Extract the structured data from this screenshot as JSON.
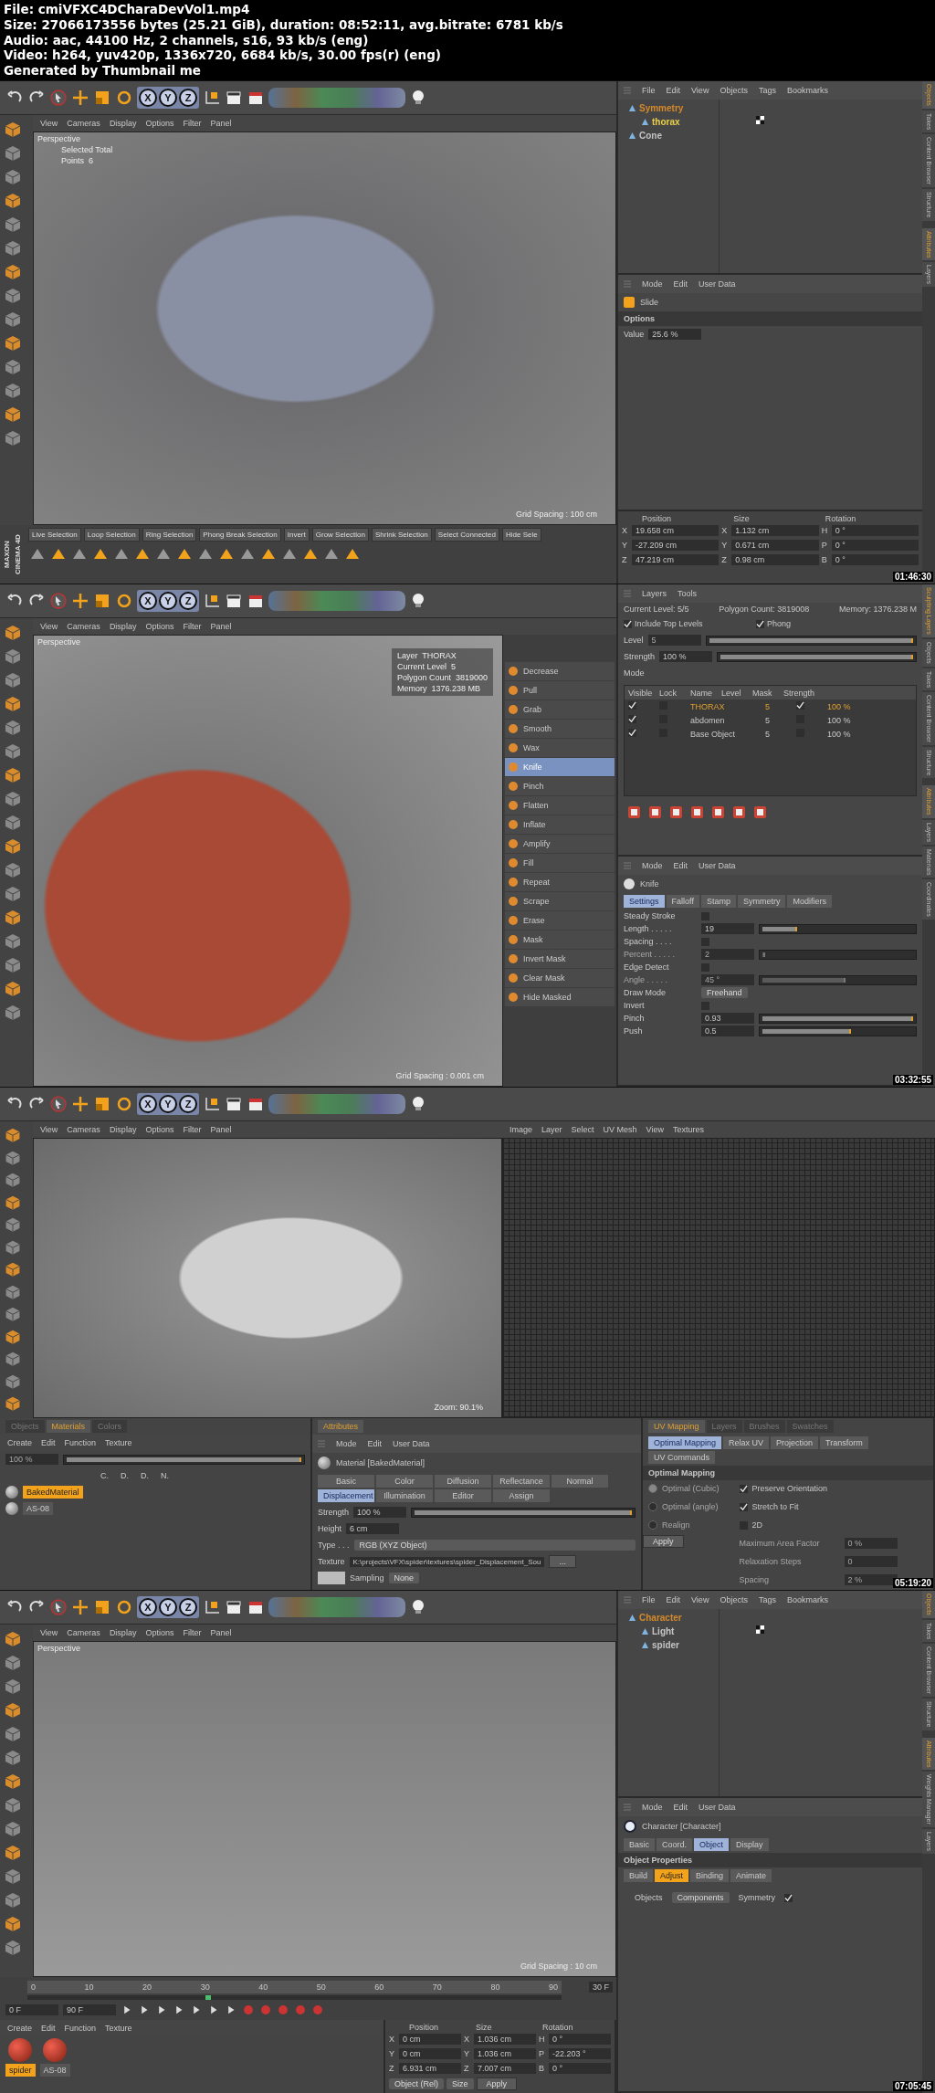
{
  "header": {
    "lines": [
      "File: cmiVFXC4DCharaDevVol1.mp4",
      "Size: 27066173556 bytes (25.21 GiB), duration: 08:52:11, avg.bitrate: 6781 kb/s",
      "Audio: aac, 44100 Hz, 2 channels, s16, 93 kb/s (eng)",
      "Video: h264, yuv420p, 1336x720, 6684 kb/s, 30.00 fps(r) (eng)",
      "Generated by Thumbnail me"
    ]
  },
  "frames": [
    {
      "kind": "modeling",
      "timestamp": "01:46:30",
      "toolbar": {
        "axes": [
          "X",
          "Y",
          "Z"
        ]
      },
      "viewport": {
        "menu": [
          "View",
          "Cameras",
          "Display",
          "Options",
          "Filter",
          "Panel"
        ],
        "camera": "Perspective",
        "info": [
          "Selected Total",
          "Points  6"
        ],
        "grid": "Grid Spacing : 100 cm"
      },
      "selection_bar": [
        "Live Selection",
        "Loop Selection",
        "Ring Selection",
        "Phong Break Selection",
        "Invert",
        "Grow Selection",
        "Shrink Selection",
        "Select Connected",
        "Hide Sele"
      ],
      "logo": [
        "MAXON",
        "CINEMA 4D"
      ],
      "objects": {
        "menu": [
          "File",
          "Edit",
          "View",
          "Objects",
          "Tags",
          "Bookmarks"
        ],
        "items": [
          {
            "name": "Symmetry",
            "color": "#d4892a",
            "children": [
              {
                "name": "thorax",
                "color": "#e8cf4a"
              }
            ]
          },
          {
            "name": "Cone",
            "color": "#c4c4c4"
          }
        ]
      },
      "attributes": {
        "menu": [
          "Mode",
          "Edit",
          "User Data"
        ],
        "title": "Slide",
        "section": "Options",
        "fields": [
          {
            "label": "Value",
            "value": "25.6 %"
          }
        ]
      },
      "coordinates": {
        "headers": [
          "Position",
          "Size",
          "Rotation"
        ],
        "rows": [
          {
            "pos_axis": "X",
            "position": "19.658 cm",
            "size_axis": "X",
            "size": "1.132 cm",
            "rot_axis": "H",
            "rotation": "0 °"
          },
          {
            "pos_axis": "Y",
            "position": "-27.209 cm",
            "size_axis": "Y",
            "size": "0.671 cm",
            "rot_axis": "P",
            "rotation": "0 °"
          },
          {
            "pos_axis": "Z",
            "position": "47.219 cm",
            "size_axis": "Z",
            "size": "0.98 cm",
            "rot_axis": "B",
            "rotation": "0 °"
          }
        ]
      },
      "side_tabs": [
        [
          {
            "label": "Objects",
            "selected": true
          },
          {
            "label": "Takes",
            "selected": false
          },
          {
            "label": "Content Browser",
            "selected": false
          },
          {
            "label": "Structure",
            "selected": false
          }
        ],
        [
          {
            "label": "Attributes",
            "selected": true
          },
          {
            "label": "Layers",
            "selected": false
          }
        ]
      ]
    },
    {
      "kind": "sculpt",
      "timestamp": "03:32:55",
      "toolbar": {
        "axes": [
          "X",
          "Y",
          "Z"
        ]
      },
      "viewport": {
        "menu": [
          "View",
          "Cameras",
          "Display",
          "Options",
          "Filter",
          "Panel"
        ],
        "camera": "Perspective",
        "info": [
          "Layer  THORAX",
          "Current Level  5",
          "Polygon Count  3819000",
          "Memory  1376.238 MB"
        ],
        "grid": "Grid Spacing : 0.001 cm"
      },
      "brushes": [
        {
          "name": "Decrease",
          "selected": false
        },
        {
          "name": "Pull",
          "selected": false
        },
        {
          "name": "Grab",
          "selected": false
        },
        {
          "name": "Smooth",
          "selected": false
        },
        {
          "name": "Wax",
          "selected": false
        },
        {
          "name": "Knife",
          "selected": true
        },
        {
          "name": "Pinch",
          "selected": false
        },
        {
          "name": "Flatten",
          "selected": false
        },
        {
          "name": "Inflate",
          "selected": false
        },
        {
          "name": "Amplify",
          "selected": false
        },
        {
          "name": "Fill",
          "selected": false
        },
        {
          "name": "Repeat",
          "selected": false
        },
        {
          "name": "Scrape",
          "selected": false
        },
        {
          "name": "Erase",
          "selected": false
        },
        {
          "name": "Mask",
          "selected": false
        },
        {
          "name": "Invert Mask",
          "selected": false
        },
        {
          "name": "Clear Mask",
          "selected": false
        },
        {
          "name": "Hide Masked",
          "selected": false
        }
      ],
      "layers": {
        "menu": [
          "Layers",
          "Tools"
        ],
        "stats": [
          "Current Level: 5/5",
          "Polygon Count: 3819008",
          "Memory: 1376.238 M"
        ],
        "checks": [
          {
            "label": "Include Top Levels",
            "checked": true
          },
          {
            "label": "Phong",
            "checked": true
          }
        ],
        "level_row": {
          "label": "Level",
          "value": "5",
          "level": 1
        },
        "strength": {
          "label": "Strength",
          "value": "100 %",
          "level": 1
        },
        "mode": "Mode",
        "columns": [
          "Visible",
          "Lock",
          "Name",
          "Level",
          "Mask",
          "Strength"
        ],
        "rows": [
          {
            "visible": true,
            "locked": false,
            "name": "THORAX",
            "subdivision": "5",
            "mask": true,
            "strength": "100 %",
            "selected": true
          },
          {
            "visible": true,
            "locked": false,
            "name": "abdomen",
            "subdivision": "5",
            "mask": false,
            "strength": "100 %",
            "selected": false
          },
          {
            "visible": true,
            "locked": false,
            "name": "Base Object",
            "subdivision": "5",
            "mask": false,
            "strength": "100 %",
            "selected": false
          }
        ]
      },
      "attributes": {
        "menu": [
          "Mode",
          "Edit",
          "User Data"
        ],
        "title": "Knife",
        "tabs": [
          {
            "label": "Settings",
            "selected": true
          },
          {
            "label": "Falloff",
            "selected": false
          },
          {
            "label": "Stamp",
            "selected": false
          },
          {
            "label": "Symmetry",
            "selected": false
          },
          {
            "label": "Modifiers",
            "selected": false
          }
        ],
        "settings": [
          {
            "kind": "check",
            "label": "Steady Stroke",
            "checked": false
          },
          {
            "kind": "slider",
            "label": "Length . . . . .",
            "value": "19",
            "level": 0.23,
            "disabled": false
          },
          {
            "kind": "check",
            "label": "Spacing . . . .",
            "checked": false
          },
          {
            "kind": "slider",
            "label": "Percent . . . . .",
            "value": "2",
            "level": 0.02,
            "disabled": true
          },
          {
            "kind": "check",
            "label": "Edge Detect",
            "checked": false
          },
          {
            "kind": "slider",
            "label": "Angle . . . . .",
            "value": "45 °",
            "level": 0.55,
            "disabled": true
          },
          {
            "kind": "dropdown",
            "label": "Draw Mode",
            "value": "Freehand"
          },
          {
            "kind": "check",
            "label": "Invert",
            "checked": false
          },
          {
            "kind": "slider",
            "label": "Pinch",
            "value": "0.93",
            "level": 1,
            "disabled": false
          },
          {
            "kind": "slider",
            "label": "Push",
            "value": "0.5",
            "level": 0.59,
            "disabled": false
          }
        ]
      },
      "side_tabs": [
        [
          {
            "label": "Sculpting Layers",
            "selected": true
          },
          {
            "label": "Objects",
            "selected": false
          },
          {
            "label": "Takes",
            "selected": false
          },
          {
            "label": "Content Browser",
            "selected": false
          },
          {
            "label": "Structure",
            "selected": false
          }
        ],
        [
          {
            "label": "Attributes",
            "selected": true
          },
          {
            "label": "Layers",
            "selected": false
          },
          {
            "label": "Materials",
            "selected": false
          },
          {
            "label": "Coordinates",
            "selected": false
          }
        ]
      ]
    },
    {
      "kind": "uv",
      "timestamp": "05:19:20",
      "toolbar": {
        "axes": [
          "X",
          "Y",
          "Z"
        ]
      },
      "viewport": {
        "menu": [
          "View",
          "Cameras",
          "Display",
          "Options",
          "Filter",
          "Panel"
        ],
        "zoom": "Zoom: 90.1%"
      },
      "uv_menu": [
        "Image",
        "Layer",
        "Select",
        "UV Mesh",
        "View",
        "Textures"
      ],
      "materials": {
        "tabs": [
          {
            "label": "Objects",
            "selected": false
          },
          {
            "label": "Materials",
            "selected": true
          },
          {
            "label": "Colors",
            "selected": false
          }
        ],
        "menu": [
          "Create",
          "Edit",
          "Function",
          "Texture"
        ],
        "zoom": "100 %",
        "zoom_slider": {
          "level": 1
        },
        "columns": [
          "C.",
          "D.",
          "D.",
          "N."
        ],
        "items": [
          {
            "name": "BakedMaterial",
            "selected": true
          },
          {
            "name": "AS-08",
            "selected": false
          }
        ]
      },
      "attributes": {
        "tab": "Attributes",
        "menu": [
          "Mode",
          "Edit",
          "User Data"
        ],
        "title": "Material [BakedMaterial]",
        "tabs": [
          {
            "label": "Basic",
            "selected": false
          },
          {
            "label": "Color",
            "selected": false
          },
          {
            "label": "Diffusion",
            "selected": false
          },
          {
            "label": "Reflectance",
            "selected": false
          },
          {
            "label": "Normal",
            "selected": false
          },
          {
            "label": "Displacement",
            "selected": true
          },
          {
            "label": "Illumination",
            "selected": false
          },
          {
            "label": "Editor",
            "selected": false
          },
          {
            "label": "Assign",
            "selected": false
          }
        ],
        "strength": {
          "label": "Strength",
          "value": "100 %",
          "level": 1
        },
        "height": {
          "label": "Height",
          "value": "6 cm"
        },
        "type": {
          "label": "Type . . .",
          "value": "RGB (XYZ Object)"
        },
        "texture": {
          "label": "Texture",
          "value": "K:\\projects\\VFX\\spider\\textures\\spider_Displacement_Sou",
          "button": "..."
        },
        "sampling": {
          "label": "Sampling",
          "value": "None"
        }
      },
      "uv_panel": {
        "tabs": [
          {
            "label": "UV Mapping",
            "selected": true
          },
          {
            "label": "Layers",
            "selected": false
          },
          {
            "label": "Brushes",
            "selected": false
          },
          {
            "label": "Swatches",
            "selected": false
          }
        ],
        "subtabs": [
          {
            "label": "Optimal Mapping",
            "selected": true
          },
          {
            "label": "Relax UV",
            "selected": false
          },
          {
            "label": "Projection",
            "selected": false
          },
          {
            "label": "Transform",
            "selected": false
          },
          {
            "label": "UV Commands",
            "selected": false
          }
        ],
        "heading": "Optimal Mapping",
        "radios": [
          {
            "label": "Optimal (Cubic)",
            "selected": true
          },
          {
            "label": "Optimal (angle)",
            "selected": false
          },
          {
            "label": "Realign",
            "selected": false
          }
        ],
        "checks": [
          {
            "label": "Preserve Orientation",
            "checked": true
          },
          {
            "label": "Stretch to Fit",
            "checked": true
          },
          {
            "label": "2D",
            "checked": false
          }
        ],
        "fields": [
          {
            "label": "Maximum Area Factor",
            "value": "0 %"
          },
          {
            "label": "Relaxation Steps",
            "value": "0"
          },
          {
            "label": "Spacing",
            "value": "2 %"
          }
        ],
        "button": "Apply"
      }
    },
    {
      "kind": "rig",
      "timestamp": "07:05:45",
      "toolbar": {
        "axes": [
          "X",
          "Y",
          "Z"
        ]
      },
      "viewport": {
        "menu": [
          "View",
          "Cameras",
          "Display",
          "Options",
          "Filter",
          "Panel"
        ],
        "camera": "Perspective",
        "grid": "Grid Spacing : 10 cm"
      },
      "timeline": {
        "ticks": [
          "0",
          "10",
          "20",
          "30",
          "40",
          "50",
          "60",
          "70",
          "80",
          "90"
        ],
        "current": "30 F",
        "level": 0.333,
        "start": "0 F",
        "end": "90 F"
      },
      "materials": {
        "menu": [
          "Create",
          "Edit",
          "Function",
          "Texture"
        ],
        "items": [
          {
            "name": "spider",
            "selected": true
          },
          {
            "name": "AS-08",
            "selected": false
          }
        ]
      },
      "coordinates": {
        "headers": [
          "Position",
          "Size",
          "Rotation"
        ],
        "rows": [
          {
            "pos_axis": "X",
            "position": "0 cm",
            "size_axis": "X",
            "size": "1.036 cm",
            "rot_axis": "H",
            "rotation": "0 °"
          },
          {
            "pos_axis": "Y",
            "position": "0 cm",
            "size_axis": "Y",
            "size": "1.036 cm",
            "rot_axis": "P",
            "rotation": "-22.203 °"
          },
          {
            "pos_axis": "Z",
            "position": "6.931 cm",
            "size_axis": "Z",
            "size": "7.007 cm",
            "rot_axis": "B",
            "rotation": "0 °"
          }
        ],
        "footer": [
          "Object (Rel)",
          "Size"
        ],
        "button": "Apply"
      },
      "objects": {
        "menu": [
          "File",
          "Edit",
          "View",
          "Objects",
          "Tags",
          "Bookmarks"
        ],
        "items": [
          {
            "name": "Character",
            "color": "#d4892a",
            "children": [
              {
                "name": "Light",
                "color": "#c4c4c4"
              },
              {
                "name": "spider",
                "color": "#c4c4c4"
              }
            ]
          }
        ]
      },
      "attributes": {
        "menu": [
          "Mode",
          "Edit",
          "User Data"
        ],
        "title": "Character [Character]",
        "tabs": [
          {
            "label": "Basic",
            "selected": false
          },
          {
            "label": "Coord.",
            "selected": false
          },
          {
            "label": "Object",
            "selected": true
          },
          {
            "label": "Display",
            "selected": false
          }
        ],
        "section": "Object Properties",
        "subtabs": [
          {
            "label": "Build",
            "selected": false
          },
          {
            "label": "Adjust",
            "selected": true
          },
          {
            "label": "Binding",
            "selected": false
          },
          {
            "label": "Animate",
            "selected": false
          }
        ],
        "objects_label": "Objects",
        "objects_value": "Components",
        "symmetry": {
          "label": "Symmetry",
          "checked": true
        }
      },
      "side_tabs": [
        [
          {
            "label": "Objects",
            "selected": true
          },
          {
            "label": "Takes",
            "selected": false
          },
          {
            "label": "Content Browser",
            "selected": false
          },
          {
            "label": "Structure",
            "selected": false
          }
        ],
        [
          {
            "label": "Attributes",
            "selected": true
          },
          {
            "label": "Weights Manager",
            "selected": false
          },
          {
            "label": "Layers",
            "selected": false
          }
        ]
      ]
    }
  ]
}
